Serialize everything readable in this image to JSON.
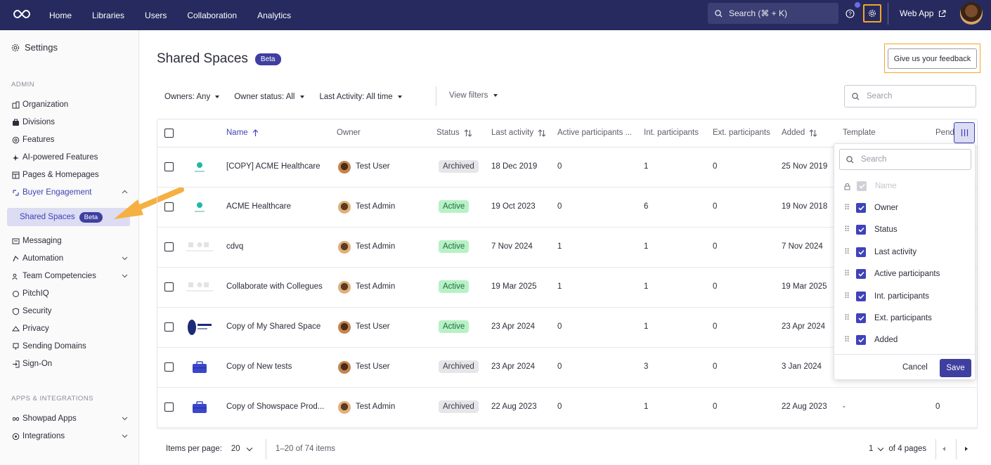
{
  "topbar": {
    "nav": [
      "Home",
      "Libraries",
      "Users",
      "Collaboration",
      "Analytics"
    ],
    "search_placeholder": "Search (⌘ + K)",
    "web_app": "Web App"
  },
  "sidebar": {
    "title": "Settings",
    "section_admin": "ADMIN",
    "items": [
      {
        "label": "Organization",
        "icon": "building-icon"
      },
      {
        "label": "Divisions",
        "icon": "briefcase-icon"
      },
      {
        "label": "Features",
        "icon": "gear-icon"
      },
      {
        "label": "AI-powered Features",
        "icon": "sparkle-icon"
      },
      {
        "label": "Pages & Homepages",
        "icon": "layout-icon"
      },
      {
        "label": "Buyer Engagement",
        "icon": "engagement-icon"
      },
      {
        "label": "Messaging",
        "icon": "message-icon"
      },
      {
        "label": "Automation",
        "icon": "automation-icon"
      },
      {
        "label": "Team Competencies",
        "icon": "team-icon"
      },
      {
        "label": "PitchIQ",
        "icon": "pitchiq-icon"
      },
      {
        "label": "Security",
        "icon": "shield-icon"
      },
      {
        "label": "Privacy",
        "icon": "privacy-icon"
      },
      {
        "label": "Sending Domains",
        "icon": "domain-icon"
      },
      {
        "label": "Sign-On",
        "icon": "signin-icon"
      }
    ],
    "sub_item": "Shared Spaces",
    "sub_badge": "Beta",
    "section_apps": "APPS & INTEGRATIONS",
    "apps": [
      {
        "label": "Showpad Apps",
        "icon": "infinity-icon"
      },
      {
        "label": "Integrations",
        "icon": "integrations-icon"
      }
    ]
  },
  "main": {
    "title": "Shared Spaces",
    "badge": "Beta",
    "feedback": "Give us your feedback",
    "filters": [
      "Owners: Any",
      "Owner status: All",
      "Last Activity: All time"
    ],
    "view_filters": "View filters",
    "search_placeholder": "Search"
  },
  "table": {
    "headers": {
      "name": "Name",
      "owner": "Owner",
      "status": "Status",
      "last_activity": "Last activity",
      "active_participants": "Active participants ...",
      "int_participants": "Int. participants",
      "ext_participants": "Ext. participants",
      "added": "Added",
      "template": "Template",
      "pending": "Pend"
    },
    "rows": [
      {
        "name": "[COPY] ACME Healthcare",
        "owner": "Test User",
        "status": "Archived",
        "last_activity": "18 Dec 2019",
        "active": "0",
        "int": "1",
        "ext": "0",
        "added": "25 Nov 2019",
        "template": "",
        "pending": ""
      },
      {
        "name": "ACME Healthcare",
        "owner": "Test Admin",
        "status": "Active",
        "last_activity": "19 Oct 2023",
        "active": "0",
        "int": "6",
        "ext": "0",
        "added": "19 Nov 2018",
        "template": "",
        "pending": ""
      },
      {
        "name": "cdvq",
        "owner": "Test Admin",
        "status": "Active",
        "last_activity": "7 Nov 2024",
        "active": "1",
        "int": "1",
        "ext": "0",
        "added": "7 Nov 2024",
        "template": "",
        "pending": ""
      },
      {
        "name": "Collaborate with Collegues",
        "owner": "Test Admin",
        "status": "Active",
        "last_activity": "19 Mar 2025",
        "active": "1",
        "int": "1",
        "ext": "0",
        "added": "19 Mar 2025",
        "template": "",
        "pending": ""
      },
      {
        "name": "Copy of My Shared Space",
        "owner": "Test User",
        "status": "Active",
        "last_activity": "23 Apr 2024",
        "active": "0",
        "int": "1",
        "ext": "0",
        "added": "23 Apr 2024",
        "template": "",
        "pending": ""
      },
      {
        "name": "Copy of New tests",
        "owner": "Test User",
        "status": "Archived",
        "last_activity": "23 Apr 2024",
        "active": "0",
        "int": "3",
        "ext": "0",
        "added": "3 Jan 2024",
        "template": "",
        "pending": ""
      },
      {
        "name": "Copy of Showspace Prod...",
        "owner": "Test Admin",
        "status": "Archived",
        "last_activity": "22 Aug 2023",
        "active": "0",
        "int": "1",
        "ext": "0",
        "added": "22 Aug 2023",
        "template": "-",
        "pending": "0"
      }
    ]
  },
  "column_popup": {
    "search_placeholder": "Search",
    "columns": [
      "Name",
      "Owner",
      "Status",
      "Last activity",
      "Active participants",
      "Int. participants",
      "Ext. participants",
      "Added"
    ],
    "cancel": "Cancel",
    "save": "Save"
  },
  "pagination": {
    "items_per_page_label": "Items per page:",
    "items_per_page": "20",
    "range": "1–20 of 74 items",
    "page": "1",
    "of_pages": "of 4 pages"
  },
  "colors": {
    "topbar": "#262a5f",
    "accent": "#3f42b8",
    "highlight": "#f5a623",
    "active_status": "#b7f1c6",
    "archived_status": "#e6e6e9"
  }
}
